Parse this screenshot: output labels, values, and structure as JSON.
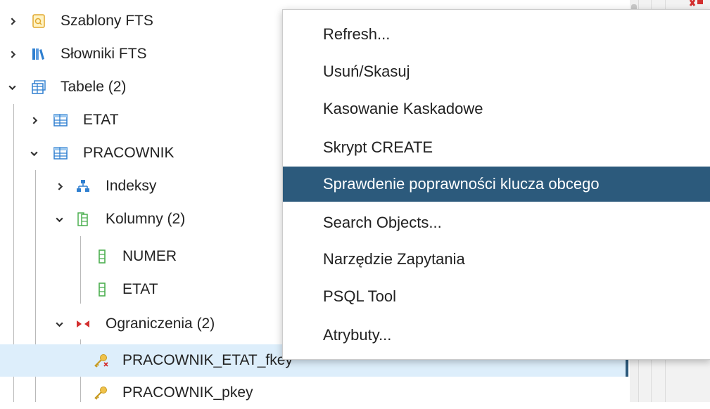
{
  "tree": {
    "items": [
      {
        "label": "Szablony FTS",
        "icon": "fts-template-icon",
        "expanded": false
      },
      {
        "label": "Słowniki FTS",
        "icon": "fts-dictionary-icon",
        "expanded": false
      },
      {
        "label": "Tabele (2)",
        "icon": "tables-icon",
        "expanded": true
      },
      {
        "label": "ETAT",
        "icon": "table-icon",
        "expanded": false
      },
      {
        "label": "PRACOWNIK",
        "icon": "table-icon",
        "expanded": true
      },
      {
        "label": "Indeksy",
        "icon": "indexes-icon",
        "expanded": false
      },
      {
        "label": "Kolumny (2)",
        "icon": "columns-icon",
        "expanded": true
      },
      {
        "label": "NUMER",
        "icon": "column-icon"
      },
      {
        "label": "ETAT",
        "icon": "column-icon"
      },
      {
        "label": "Ograniczenia (2)",
        "icon": "constraints-icon",
        "expanded": true
      },
      {
        "label": "PRACOWNIK_ETAT_fkey",
        "icon": "foreign-key-icon",
        "selected": true
      },
      {
        "label": "PRACOWNIK_pkey",
        "icon": "primary-key-icon"
      }
    ]
  },
  "context_menu": {
    "items": [
      {
        "label": "Refresh..."
      },
      {
        "label": "Usuń/Skasuj"
      },
      {
        "label": "Kasowanie Kaskadowe"
      },
      {
        "label": "Skrypt CREATE"
      },
      {
        "label": "Sprawdenie poprawności klucza obcego",
        "highlighted": true
      },
      {
        "label": "Search Objects..."
      },
      {
        "label": "Narzędzie Zapytania"
      },
      {
        "label": "PSQL Tool"
      },
      {
        "label": "Atrybuty..."
      }
    ]
  },
  "colors": {
    "menu_highlight": "#2c5a7c",
    "selected_row": "#ddeefb",
    "icon_blue": "#2f7fd0",
    "icon_green": "#4caf50",
    "icon_red": "#d32f2f",
    "icon_gold": "#e0a82e"
  }
}
